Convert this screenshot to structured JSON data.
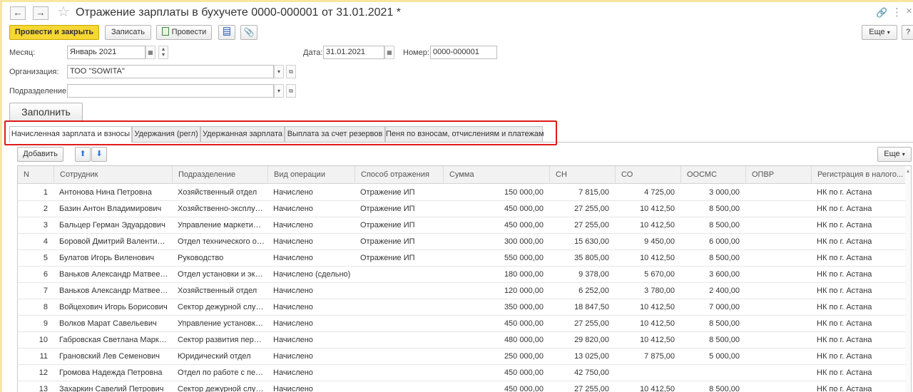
{
  "title": "Отражение зарплаты в бухучете 0000-000001 от 31.01.2021 *",
  "nav": {
    "back": "←",
    "forward": "→",
    "star": "☆"
  },
  "title_icons": {
    "link": "🔗",
    "more": "⋮",
    "close": "×"
  },
  "toolbar": {
    "post_close": "Провести и закрыть",
    "save": "Записать",
    "post": "Провести",
    "more": "Еще",
    "help": "?"
  },
  "form": {
    "month_label": "Месяц:",
    "month_value": "Январь 2021",
    "date_label": "Дата:",
    "date_value": "31.01.2021",
    "number_label": "Номер:",
    "number_value": "0000-000001",
    "org_label": "Организация:",
    "org_value": "ТОО \"SOWITA\"",
    "dept_label": "Подразделение:",
    "dept_value": "",
    "fill_button": "Заполнить"
  },
  "tabs": [
    {
      "label": "Начисленная зарплата и взносы"
    },
    {
      "label": "Удержания (регл)"
    },
    {
      "label": "Удержанная зарплата"
    },
    {
      "label": "Выплата за счет резервов"
    },
    {
      "label": "Пеня по взносам, отчислениям и платежам"
    }
  ],
  "table_toolbar": {
    "add": "Добавить",
    "up": "⬆",
    "down": "⬇",
    "more": "Еще"
  },
  "table": {
    "columns": [
      "N",
      "Сотрудник",
      "Подразделение",
      "Вид операции",
      "Способ отражения",
      "Сумма",
      "СН",
      "СО",
      "ООСМС",
      "ОПВР",
      "Регистрация в налого..."
    ],
    "rows": [
      [
        "1",
        "Антонова Нина Петровна",
        "Хозяйственный отдел",
        "Начислено",
        "Отражение ИП",
        "150 000,00",
        "7 815,00",
        "4 725,00",
        "3 000,00",
        "",
        "НК по г. Астана"
      ],
      [
        "2",
        "Базин Антон Владимирович",
        "Хозяйственно-эксплуат...",
        "Начислено",
        "Отражение ИП",
        "450 000,00",
        "27 255,00",
        "10 412,50",
        "8 500,00",
        "",
        "НК по г. Астана"
      ],
      [
        "3",
        "Бальцер Герман Эдуардович",
        "Управление маркетинга...",
        "Начислено",
        "Отражение ИП",
        "450 000,00",
        "27 255,00",
        "10 412,50",
        "8 500,00",
        "",
        "НК по г. Астана"
      ],
      [
        "4",
        "Боровой Дмитрий Валентинов...",
        "Отдел технического об...",
        "Начислено",
        "Отражение ИП",
        "300 000,00",
        "15 630,00",
        "9 450,00",
        "6 000,00",
        "",
        "НК по г. Астана"
      ],
      [
        "5",
        "Булатов Игорь Виленович",
        "Руководство",
        "Начислено",
        "Отражение ИП",
        "550 000,00",
        "35 805,00",
        "10 412,50",
        "8 500,00",
        "",
        "НК по г. Астана"
      ],
      [
        "6",
        "Ваньков Александр Матвеевич",
        "Отдел установки и экс...",
        "Начислено (сдельно)",
        "",
        "180 000,00",
        "9 378,00",
        "5 670,00",
        "3 600,00",
        "",
        "НК по г. Астана"
      ],
      [
        "7",
        "Ваньков Александр Матвеевич",
        "Хозяйственный отдел",
        "Начислено",
        "",
        "120 000,00",
        "6 252,00",
        "3 780,00",
        "2 400,00",
        "",
        "НК по г. Астана"
      ],
      [
        "8",
        "Войцехович Игорь Борисович",
        "Сектор дежурной службы",
        "Начислено",
        "",
        "350 000,00",
        "18 847,50",
        "10 412,50",
        "7 000,00",
        "",
        "НК по г. Астана"
      ],
      [
        "9",
        "Волков Марат Савельевич",
        "Управление установки ...",
        "Начислено",
        "",
        "450 000,00",
        "27 255,00",
        "10 412,50",
        "8 500,00",
        "",
        "НК по г. Астана"
      ],
      [
        "10",
        "Габровская Светлана Марковна",
        "Сектор развития персо...",
        "Начислено",
        "",
        "480 000,00",
        "29 820,00",
        "10 412,50",
        "8 500,00",
        "",
        "НК по г. Астана"
      ],
      [
        "11",
        "Грановский Лев Семенович",
        "Юридический отдел",
        "Начислено",
        "",
        "250 000,00",
        "13 025,00",
        "7 875,00",
        "5 000,00",
        "",
        "НК по г. Астана"
      ],
      [
        "12",
        "Громова Надежда Петровна",
        "Отдел по работе с перс...",
        "Начислено",
        "",
        "450 000,00",
        "42 750,00",
        "",
        "",
        "",
        "НК по г. Астана"
      ],
      [
        "13",
        "Захаркин Савелий Петрович",
        "Сектор дежурной службы",
        "Начислено",
        "",
        "450 000,00",
        "27 255,00",
        "10 412,50",
        "8 500,00",
        "",
        "НК по г. Астана"
      ]
    ]
  }
}
